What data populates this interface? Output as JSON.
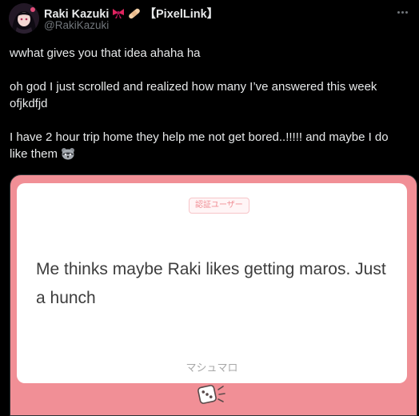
{
  "author": {
    "display_name": "Raki Kazuki",
    "badge_text": "【PixelLink】",
    "handle": "@RakiKazuki"
  },
  "tweet": {
    "lines": [
      "wwhat gives you that idea ahaha ha",
      "oh god I just scrolled and realized how many I’ve answered this week ofjkdfjd",
      "I have 2 hour trip home they help me not get bored..!!!!! and maybe I do like them"
    ]
  },
  "media": {
    "verified_label": "認証ユーザー",
    "message": "Me thinks maybe Raki likes getting maros. Just a hunch",
    "brand": "マシュマロ"
  },
  "icons": {
    "more": "more-icon",
    "ribbon": "ribbon-emoji-icon",
    "bandage": "bandage-emoji-icon",
    "raccoon": "raccoon-emoji-icon",
    "dice": "dice-logo-icon"
  },
  "colors": {
    "background": "#000000",
    "text": "#e7e9ea",
    "secondary": "#71767b",
    "media_frame": "#f18f96",
    "badge": "#f08e95"
  }
}
